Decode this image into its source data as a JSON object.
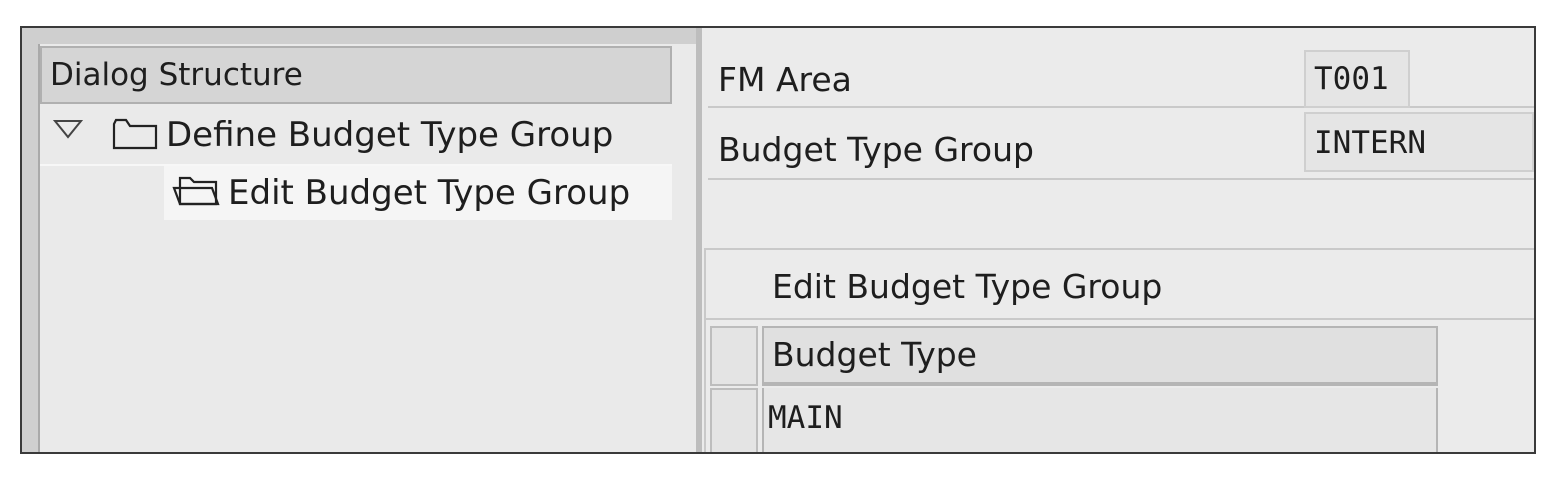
{
  "dialog_structure": {
    "header": "Dialog Structure",
    "items": [
      {
        "label": "Define Budget Type Group",
        "icon": "folder-icon",
        "expanded": true
      },
      {
        "label": "Edit Budget Type Group",
        "icon": "open-folder-icon",
        "selected": true
      }
    ]
  },
  "fields": {
    "fm_area": {
      "label": "FM Area",
      "value": "T001"
    },
    "budget_type_group": {
      "label": "Budget Type Group",
      "value": "INTERN"
    }
  },
  "table": {
    "title": "Edit Budget Type Group",
    "columns": [
      "Budget Type"
    ],
    "rows": [
      [
        "MAIN"
      ]
    ]
  }
}
